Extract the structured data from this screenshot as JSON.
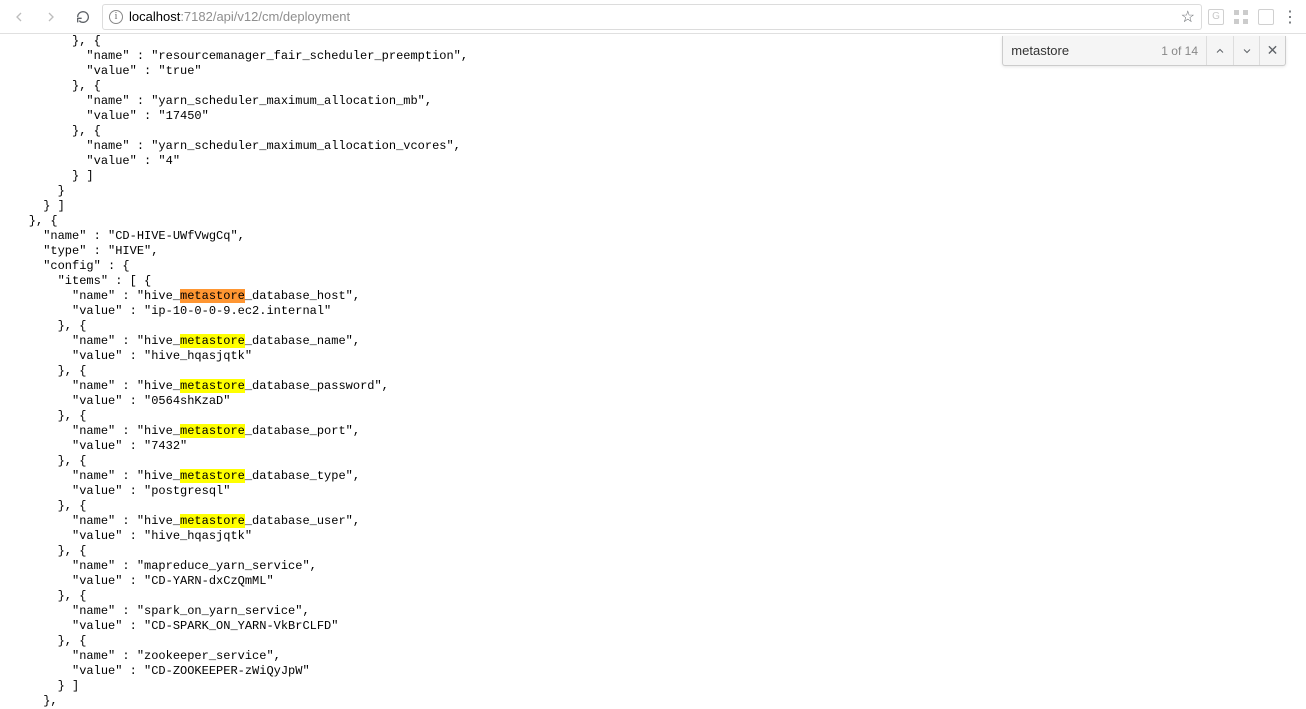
{
  "browser": {
    "url_host": "localhost",
    "url_rest": ":7182/api/v12/cm/deployment"
  },
  "find": {
    "query": "metastore",
    "count_text": "1 of 14"
  },
  "code": {
    "pre_lines": [
      "          }, {",
      "            \"name\" : \"resourcemanager_fair_scheduler_preemption\",",
      "            \"value\" : \"true\"",
      "          }, {",
      "            \"name\" : \"yarn_scheduler_maximum_allocation_mb\",",
      "            \"value\" : \"17450\"",
      "          }, {",
      "            \"name\" : \"yarn_scheduler_maximum_allocation_vcores\",",
      "            \"value\" : \"4\"",
      "          } ]",
      "        }",
      "      } ]",
      "    }, {",
      "      \"name\" : \"CD-HIVE-UWfVwgCq\",",
      "      \"type\" : \"HIVE\",",
      "      \"config\" : {",
      "        \"items\" : [ {"
    ],
    "hive_items": [
      {
        "is_current": true,
        "prefix": "hive_",
        "match": "metastore",
        "suffix": "_database_host",
        "value": "ip-10-0-0-9.ec2.internal"
      },
      {
        "is_current": false,
        "prefix": "hive_",
        "match": "metastore",
        "suffix": "_database_name",
        "value": "hive_hqasjqtk"
      },
      {
        "is_current": false,
        "prefix": "hive_",
        "match": "metastore",
        "suffix": "_database_password",
        "value": "0564shKzaD"
      },
      {
        "is_current": false,
        "prefix": "hive_",
        "match": "metastore",
        "suffix": "_database_port",
        "value": "7432"
      },
      {
        "is_current": false,
        "prefix": "hive_",
        "match": "metastore",
        "suffix": "_database_type",
        "value": "postgresql"
      },
      {
        "is_current": false,
        "prefix": "hive_",
        "match": "metastore",
        "suffix": "_database_user",
        "value": "hive_hqasjqtk"
      }
    ],
    "plain_items": [
      {
        "name": "mapreduce_yarn_service",
        "value": "CD-YARN-dxCzQmML"
      },
      {
        "name": "spark_on_yarn_service",
        "value": "CD-SPARK_ON_YARN-VkBrCLFD"
      },
      {
        "name": "zookeeper_service",
        "value": "CD-ZOOKEEPER-zWiQyJpW"
      }
    ],
    "post_lines": [
      "        } ]",
      "      },"
    ]
  }
}
